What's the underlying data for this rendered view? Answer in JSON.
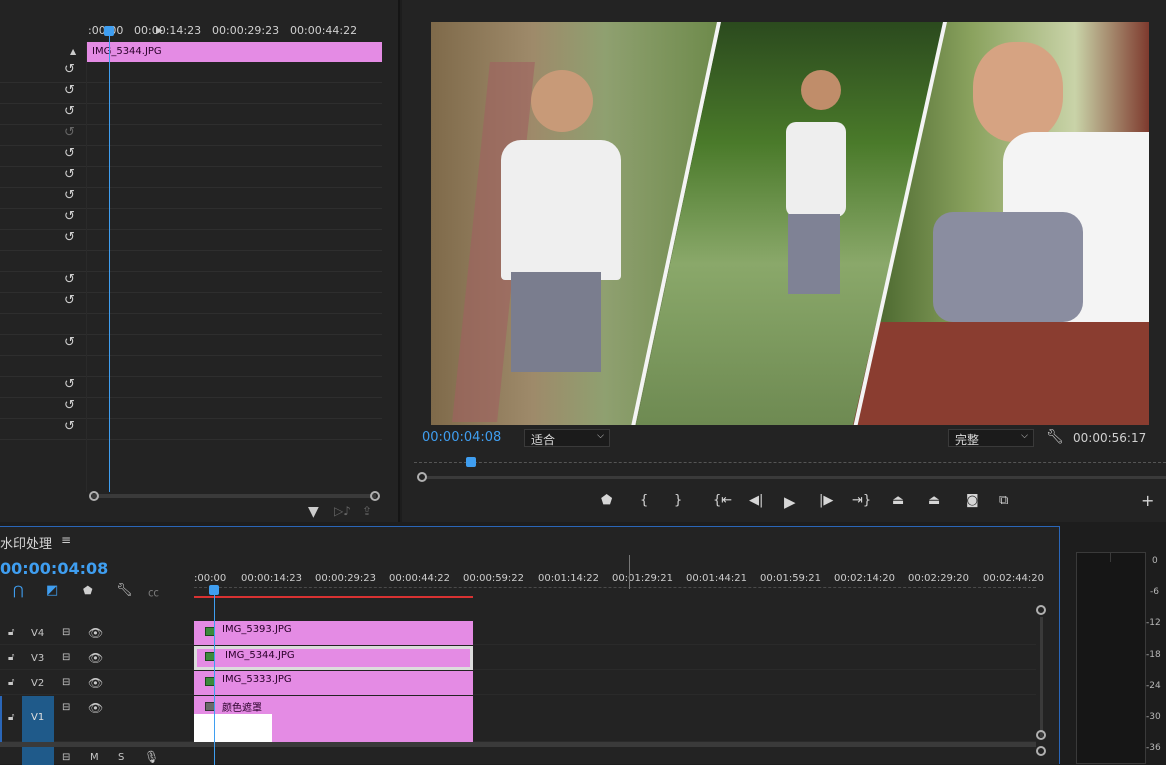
{
  "effect_controls": {
    "timecodes": [
      ":00:00",
      "00:00:14:23",
      "00:00:29:23",
      "00:00:44:22"
    ],
    "clip_name": "IMG_5344.JPG"
  },
  "program_monitor": {
    "current_time": "00:00:04:08",
    "zoom": "适合",
    "quality": "完整",
    "duration": "00:00:56:17"
  },
  "sequence": {
    "name": "水印处理",
    "current_time": "00:00:04:08",
    "ruler": [
      ":00:00",
      "00:00:14:23",
      "00:00:29:23",
      "00:00:44:22",
      "00:00:59:22",
      "00:01:14:22",
      "00:01:29:21",
      "00:01:44:21",
      "00:01:59:21",
      "00:02:14:20",
      "00:02:29:20",
      "00:02:44:20"
    ],
    "tracks": [
      {
        "name": "V4",
        "clip": "IMG_5393.JPG"
      },
      {
        "name": "V3",
        "clip": "IMG_5344.JPG"
      },
      {
        "name": "V2",
        "clip": "IMG_5333.JPG"
      },
      {
        "name": "V1",
        "clip": "颜色遮罩"
      }
    ],
    "audio_m": "M",
    "audio_s": "S"
  },
  "meter": {
    "labels": [
      "0",
      "-6",
      "-12",
      "-18",
      "-24",
      "-30",
      "-36"
    ]
  },
  "colors": {
    "accent": "#3f9ef0",
    "clip": "#e48be4",
    "selection_border": "#2a66b8"
  }
}
